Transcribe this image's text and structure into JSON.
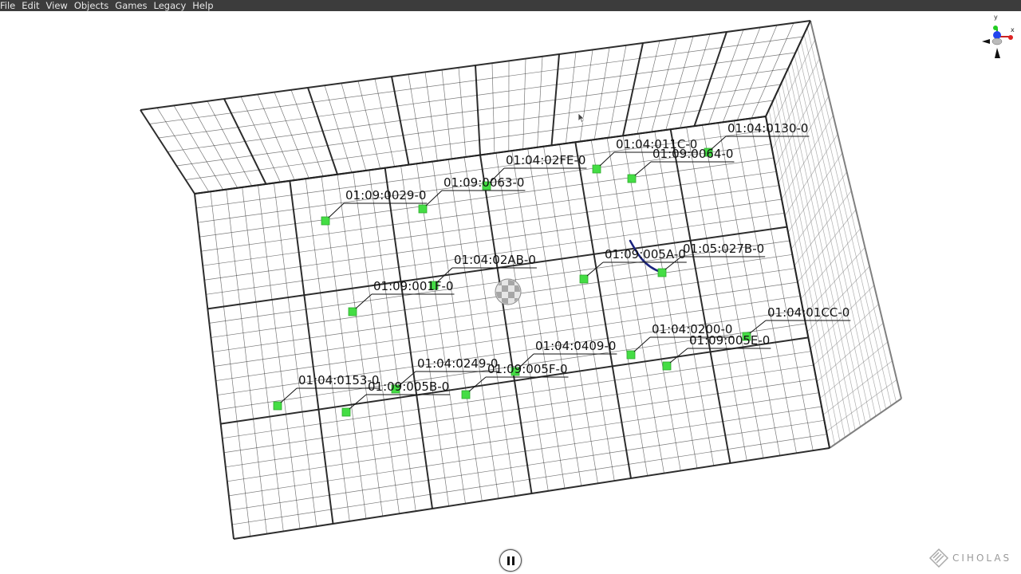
{
  "menu": [
    "File",
    "Edit",
    "View",
    "Objects",
    "Games",
    "Legacy",
    "Help"
  ],
  "tags": [
    "01:04:0130-0",
    "01:04:011C-0",
    "01:09:0064-0",
    "01:04:02FE-0",
    "01:09:0063-0",
    "01:09:0029-0",
    "01:04:02AB-0",
    "01:09:001F-0",
    "01:09:005A-0",
    "01:05:027B-0",
    "01:04:01CC-0",
    "01:04:0200-0",
    "01:09:005E-0",
    "01:04:0409-0",
    "01:04:0249-0",
    "01:09:005F-0",
    "01:04:0153-0",
    "01:09:005B-0"
  ],
  "axes": {
    "y": "y",
    "x": "x"
  },
  "brand": "CIHOLAS",
  "colors": {
    "tag_marker": "#44dd44",
    "trail": "#1a237e",
    "grid": "#222222",
    "menubar": "#3c3c3c"
  }
}
